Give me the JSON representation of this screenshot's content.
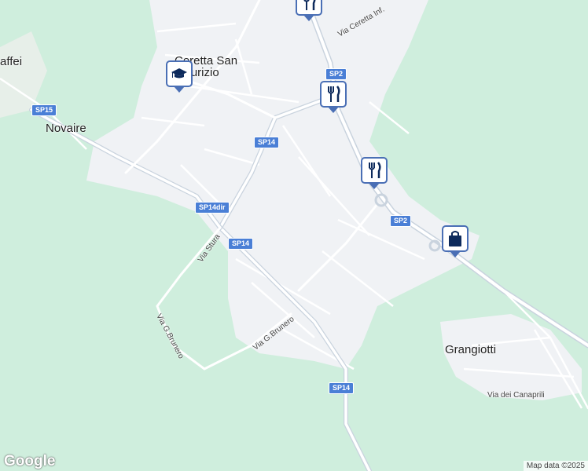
{
  "places": {
    "ceretta": "Ceretta San Maurizio",
    "novaire": "Novaire",
    "grangiotti": "Grangiotti",
    "caffei": "affei"
  },
  "streets": {
    "via_ceretta": "Via Ceretta Inf.",
    "via_stura": "Via Stura",
    "via_gbrunero_1": "Via G.Brunero",
    "via_gbrunero_2": "Via G.Brunero",
    "via_canaprili": "Via dei Canaprili"
  },
  "roads": {
    "sp2_a": "SP2",
    "sp2_b": "SP2",
    "sp14_a": "SP14",
    "sp14_b": "SP14",
    "sp14_c": "SP14",
    "sp14dir": "SP14dir",
    "sp15": "SP15"
  },
  "pois": [
    {
      "type": "school",
      "icon": "graduation-cap-icon"
    },
    {
      "type": "restaurant",
      "icon": "fork-knife-icon"
    },
    {
      "type": "restaurant",
      "icon": "fork-knife-icon"
    },
    {
      "type": "restaurant",
      "icon": "fork-knife-icon"
    },
    {
      "type": "shopping",
      "icon": "shopping-bag-icon"
    }
  ],
  "footer": {
    "logo": "Google",
    "attribution": "Map data ©2025"
  },
  "colors": {
    "land": "#cfeedd",
    "urban": "#f0f2f5",
    "road": "#ffffff",
    "major_road": "#c9d3de",
    "poi_border": "#4a6fb5",
    "shield": "#4a7fd6"
  }
}
